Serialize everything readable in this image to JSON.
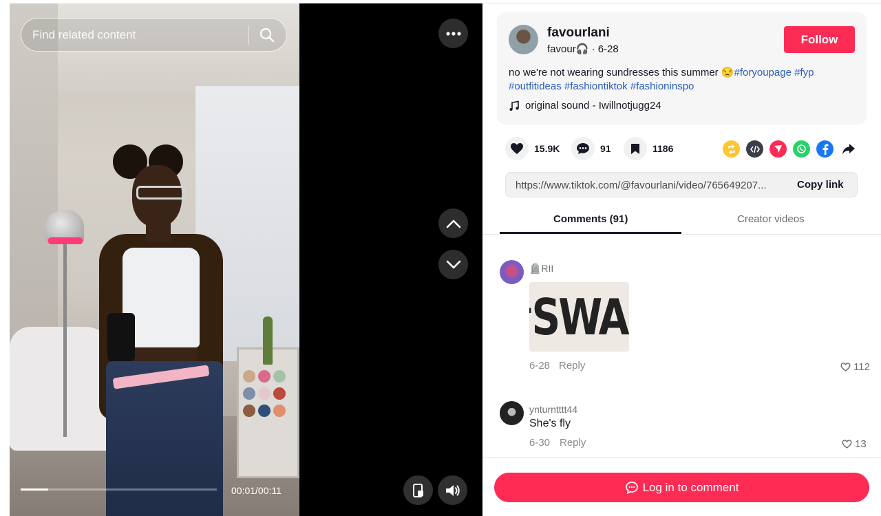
{
  "video": {
    "search_placeholder": "Find related content",
    "time": "00:01/00:11",
    "progress": 0.14
  },
  "author": {
    "username": "favourlani",
    "nickname": "favour🎧",
    "date": "6-28",
    "follow_label": "Follow"
  },
  "description": {
    "text": "no we're not wearing sundresses this summer 😒",
    "hashtags": [
      "#foryoupage",
      "#fyp",
      "#outfitideas",
      "#fashiontiktok",
      "#fashioninspo"
    ],
    "sound": "original sound - Iwillnotjugg24"
  },
  "actions": {
    "likes": "15.9K",
    "comments": "91",
    "saves": "1186"
  },
  "share_icons": [
    "repost-icon",
    "embed-icon",
    "send-icon",
    "whatsapp-icon",
    "facebook-icon",
    "share-arrow-icon"
  ],
  "link": {
    "url": "https://www.tiktok.com/@favourlani/video/765649207...",
    "copy_label": "Copy link"
  },
  "tabs": {
    "comments": "Comments (91)",
    "creator": "Creator videos"
  },
  "comments": [
    {
      "user": "🪦RII",
      "sticker": "#SWAG",
      "date": "6-28",
      "reply": "Reply",
      "likes": "112"
    },
    {
      "user": "ynturntttt44",
      "text": "She's fly",
      "date": "6-30",
      "reply": "Reply",
      "likes": "13"
    }
  ],
  "login_label": "Log in to comment",
  "colors": {
    "accent": "#fe2c55",
    "hashtag": "#2b5db9"
  }
}
